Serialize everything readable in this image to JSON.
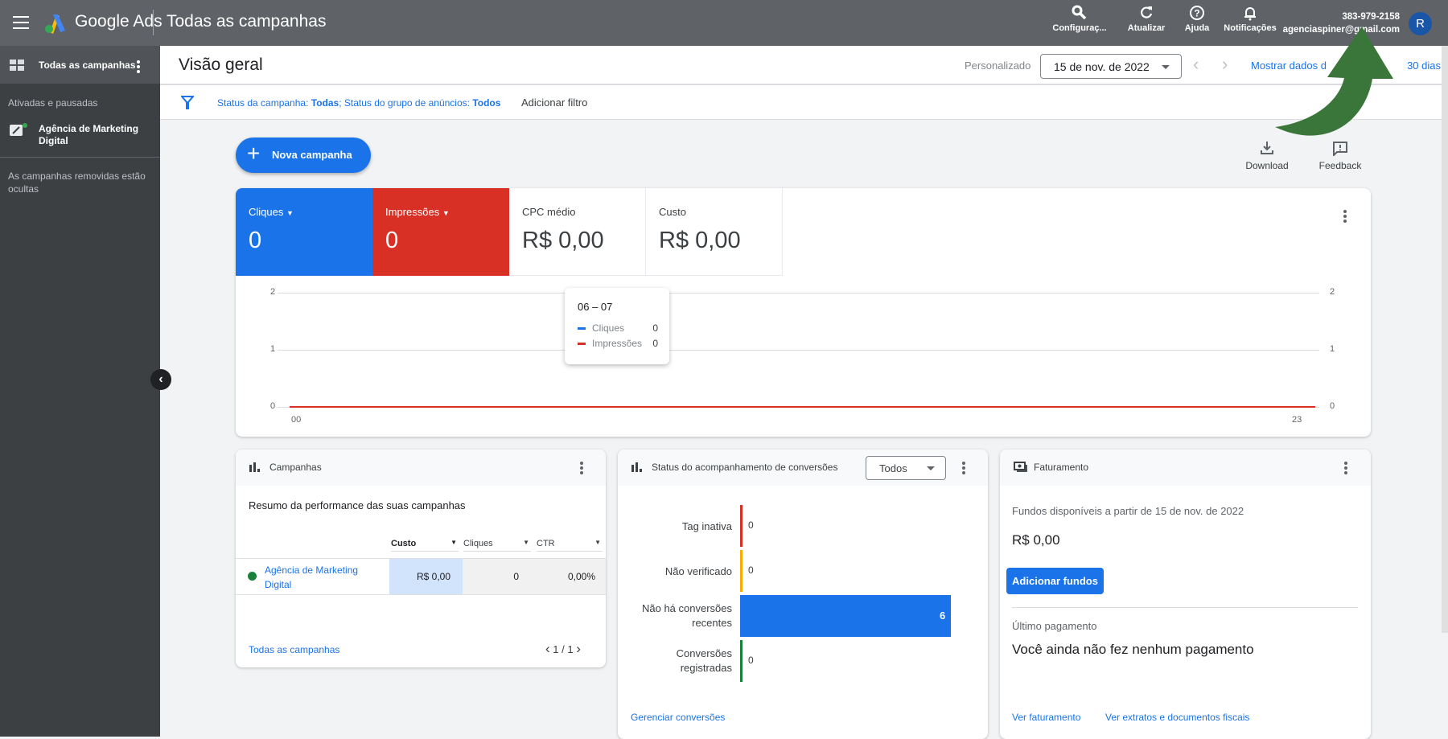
{
  "topbar": {
    "app_name": "Google Ads",
    "page": "Todas as campanhas",
    "actions": [
      {
        "label": "Configuraç...",
        "icon": "wrench-icon"
      },
      {
        "label": "Atualizar",
        "icon": "refresh-icon"
      },
      {
        "label": "Ajuda",
        "icon": "help-icon"
      },
      {
        "label": "Notificações",
        "icon": "bell-icon"
      }
    ],
    "account_id": "383-979-2158",
    "account_email": "agenciaspiner@gmail.com",
    "avatar_letter": "R"
  },
  "sidebar": {
    "top_item": "Todas as campanhas",
    "section_label": "Ativadas e pausadas",
    "campaign": "Agência de Marketing Digital",
    "removed_note": "As campanhas removidas estão ocultas"
  },
  "header": {
    "title": "Visão geral",
    "range_label": "Personalizado",
    "date": "15 de nov. de 2022",
    "compare_link_start": "Mostrar dados d",
    "compare_link_end": "30 dias"
  },
  "filter": {
    "prefix1": "Status da campanha: ",
    "value1": "Todas",
    "prefix2": "; Status do grupo de anúncios: ",
    "value2": "Todos",
    "add": "Adicionar filtro"
  },
  "toolbar": {
    "new_campaign": "Nova campanha",
    "download": "Download",
    "feedback": "Feedback"
  },
  "metrics": [
    {
      "label": "Cliques",
      "value": "0",
      "color": "#1a73e8"
    },
    {
      "label": "Impressões",
      "value": "0",
      "color": "#d93025"
    },
    {
      "label": "CPC médio",
      "value": "R$ 0,00"
    },
    {
      "label": "Custo",
      "value": "R$ 0,00"
    }
  ],
  "chart": {
    "type": "line",
    "y_ticks": [
      "2",
      "1",
      "0"
    ],
    "x_ticks": [
      "00",
      "23"
    ],
    "ylim": [
      0,
      2
    ],
    "series": [
      {
        "name": "Cliques",
        "values": [
          0,
          0
        ],
        "color": "#1a73e8"
      },
      {
        "name": "Impressões",
        "values": [
          0,
          0
        ],
        "color": "#d93025"
      }
    ],
    "tooltip": {
      "title": "06 – 07",
      "rows": [
        {
          "name": "Cliques",
          "value": "0"
        },
        {
          "name": "Impressões",
          "value": "0"
        }
      ]
    }
  },
  "campaigns_card": {
    "title": "Campanhas",
    "subtitle": "Resumo da performance das suas campanhas",
    "columns": [
      "Custo",
      "Cliques",
      "CTR"
    ],
    "rows": [
      {
        "name": "Agência de Marketing Digital",
        "custo": "R$ 0,00",
        "cliques": "0",
        "ctr": "0,00%"
      }
    ],
    "footer_link": "Todas as campanhas",
    "pagination": "1 / 1"
  },
  "conversions_card": {
    "title": "Status do acompanhamento de conversões",
    "filter": "Todos",
    "bars": [
      {
        "label": "Tag inativa",
        "value": 0,
        "color": "#d93025"
      },
      {
        "label": "Não verificado",
        "value": 0,
        "color": "#f9ab00"
      },
      {
        "label": "Não há conversões recentes",
        "value": 6,
        "color": "#1a73e8"
      },
      {
        "label": "Conversões registradas",
        "value": 0,
        "color": "#188038"
      }
    ],
    "footer_link": "Gerenciar conversões"
  },
  "billing_card": {
    "title": "Faturamento",
    "funds_label": "Fundos disponíveis a partir de 15 de nov. de 2022",
    "funds_value": "R$ 0,00",
    "add_funds": "Adicionar fundos",
    "last_payment_label": "Último pagamento",
    "last_payment_value": "Você ainda não fez nenhum pagamento",
    "link1": "Ver faturamento",
    "link2": "Ver extratos e documentos fiscais"
  }
}
